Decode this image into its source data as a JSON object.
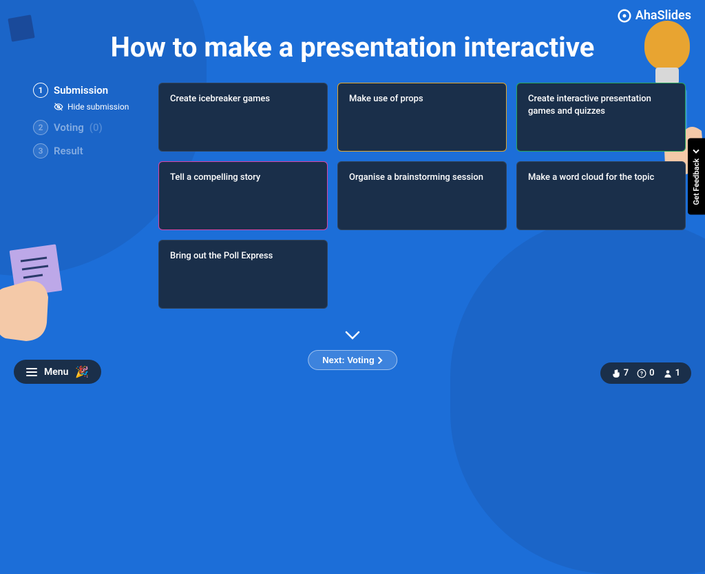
{
  "brand": "AhaSlides",
  "title": "How to make a presentation interactive",
  "steps": {
    "submission": {
      "num": "1",
      "label": "Submission"
    },
    "hide": "Hide submission",
    "voting": {
      "num": "2",
      "label": "Voting",
      "count": "(0)"
    },
    "result": {
      "num": "3",
      "label": "Result"
    }
  },
  "cards": [
    "Create icebreaker games",
    "Make use of props",
    "Create interactive presentation games and quizzes",
    "Tell a compelling story",
    "Organise a brainstorming session",
    "Make a word cloud for the topic",
    "Bring out the Poll Express"
  ],
  "nextBtn": "Next: Voting",
  "menu": "Menu",
  "feedback": "Get Feedback",
  "stats": {
    "hand": "7",
    "help": "0",
    "users": "1"
  }
}
